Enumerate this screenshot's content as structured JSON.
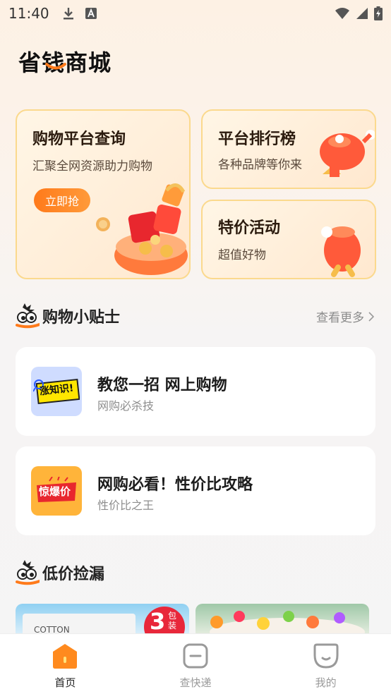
{
  "status_bar": {
    "time": "11:40"
  },
  "app": {
    "title": "省钱商城"
  },
  "cards": {
    "platform_query": {
      "title": "购物平台查询",
      "subtitle": "汇聚全网资源助力购物",
      "button": "立即抢"
    },
    "ranking": {
      "title": "平台排行榜",
      "subtitle": "各种品牌等你来"
    },
    "deals": {
      "title": "特价活动",
      "subtitle": "超值好物"
    }
  },
  "tips_section": {
    "title": "购物小贴士",
    "more": "查看更多",
    "items": [
      {
        "title": "教您一招  网上购物",
        "subtitle": "网购必杀技",
        "thumb_text": "涨知识!"
      },
      {
        "title": "网购必看！性价比攻略",
        "subtitle": "性价比之王",
        "thumb_text": "惊爆价"
      }
    ]
  },
  "low_price_section": {
    "title": "低价捡漏",
    "products": [
      {
        "label": "COTTON",
        "badge": "3",
        "badge_sub": "包装"
      }
    ]
  },
  "bottom_nav": {
    "items": [
      {
        "label": "首页",
        "active": true
      },
      {
        "label": "查快递",
        "active": false
      },
      {
        "label": "我的",
        "active": false
      }
    ]
  },
  "colors": {
    "accent": "#ff8a1e",
    "nav_active": "#222222",
    "nav_inactive": "#9a9a9a"
  }
}
